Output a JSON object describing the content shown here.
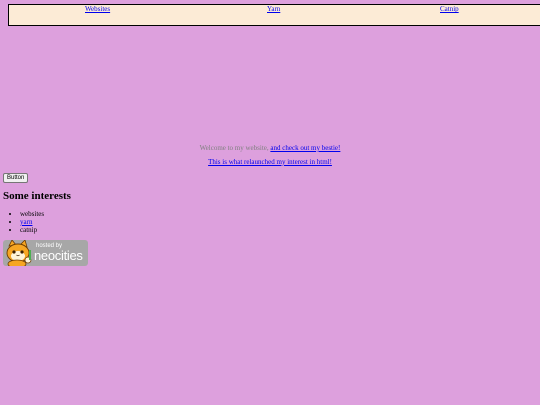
{
  "nav": {
    "websites_label": "Websites",
    "yarn_label": "Yarn",
    "catnip_label": "Catnip"
  },
  "welcome": {
    "text": "Welcome to my website,",
    "link": "and check out my bestie!"
  },
  "relaunch_link": "This is what relaunched my interest in html!",
  "button_label": "Button",
  "interests": {
    "heading": "Some interests",
    "items": [
      "websites",
      "yarn",
      "catnip"
    ]
  },
  "badge": {
    "hosted_text": "hosted by",
    "brand": "neocities"
  },
  "colors": {
    "background": "#dda0dd",
    "nav_background": "#fcebd6",
    "link": "#0000ee",
    "badge_background": "#a7a7a7"
  }
}
